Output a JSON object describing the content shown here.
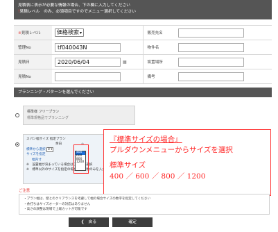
{
  "header": {
    "line1": "見積表に表示が必要な情報の場合、下の欄に入力してください",
    "line2_mark": "!",
    "line2": "見積レベル　のみ、必須項目ですのでメニュー選択してください"
  },
  "form": {
    "level_label": "見積レベル",
    "level_required_mark": "※",
    "level_value": "価格検索",
    "sales_label": "販売先名",
    "sales_value": "",
    "manage_label": "管理No",
    "manage_value": "tf040043N",
    "property_label": "物件名",
    "property_value": "",
    "date_label": "見積日",
    "date_value": "2020/06/04",
    "install_label": "設置場所",
    "install_value": "",
    "estimate_no_label": "見積No",
    "estimate_no_value": "",
    "remarks_label": "備考",
    "remarks_value": ""
  },
  "plan_section": {
    "title": "プランニング・パターンを選んでください",
    "free_plan_title": "標準様 フリープラン",
    "free_plan_sub": "標準規格品でプランニング",
    "span_plan_title": "スパン幅サイズ 指定プラン",
    "span_col_label": "余白",
    "span_col_num": "①",
    "span_row1_label": "標準から選択",
    "span_row1_value": "8",
    "span_row2_label": "サイズを指定",
    "span_row3_label": "幅内寸",
    "span_note1": "※　設置幅が決まっている場合はこちらを選択",
    "span_note2": "※　標準以外のサイズを指定の場合は、幅数のみを入力"
  },
  "dropdown": {
    "options": [
      "400",
      "600",
      "800",
      "1200"
    ],
    "highlighted": "400"
  },
  "callout": {
    "title": "『標準サイズの場合』",
    "line2": "プルダウンメニューからサイズを選択",
    "line3": "標準サイズ",
    "line4": "400 ／ 600 ／ 800 ／ 1200"
  },
  "notes": {
    "title": "ご注意",
    "items": [
      "・プラン幅は、壁とのクリアランスを考慮して幅の場合サイズの数字を指定してください",
      "・余打ちはサイズオーダーの対応はありません",
      "・高さの調整は現場で上端カットが可能です"
    ]
  },
  "buttons": {
    "back": "戻る",
    "confirm": "確定"
  },
  "colors": {
    "header_bg": "#555555",
    "accent_red": "#ff2525",
    "button_bg": "#3d3d3d"
  }
}
